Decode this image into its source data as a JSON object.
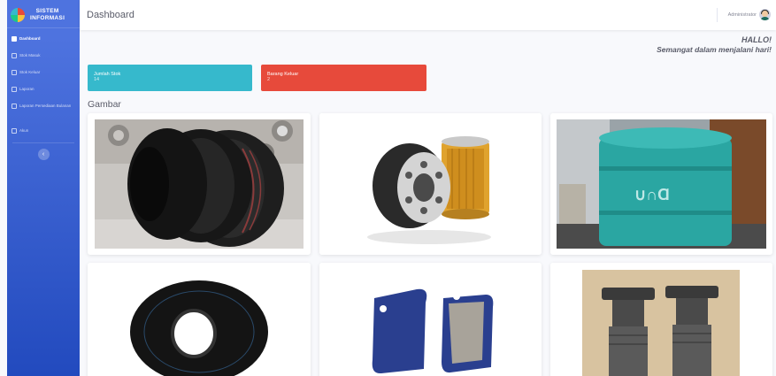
{
  "brand": {
    "line1": "SISTEM",
    "line2": "INFORMASI"
  },
  "sidebar": {
    "items": [
      {
        "label": "Dashboard",
        "icon": "dashboard-icon"
      },
      {
        "label": "Stok Masuk",
        "icon": "list-icon"
      },
      {
        "label": "Stok Keluar",
        "icon": "list-icon"
      },
      {
        "label": "Laporan",
        "icon": "report-icon"
      },
      {
        "label": "Laporan Persediaan Bulanan",
        "icon": "report-icon"
      },
      {
        "label": "Akun",
        "icon": "user-icon"
      }
    ],
    "toggle_icon": "chevron-left-icon"
  },
  "topbar": {
    "title": "Dashboard",
    "user_name": "Administrator"
  },
  "greeting": {
    "line1": "HALLO!",
    "line2": "Semangat dalam menjalani hari!"
  },
  "stats": [
    {
      "label": "Jumlah Stok",
      "value": "14",
      "color": "#36b9cc"
    },
    {
      "label": "Barang Keluar",
      "value": "2",
      "color": "#e74a3b"
    }
  ],
  "gallery": {
    "title": "Gambar",
    "items": [
      {
        "subject": "tires"
      },
      {
        "subject": "oil-filters"
      },
      {
        "subject": "oil-drum"
      },
      {
        "subject": "inner-tube"
      },
      {
        "subject": "brake-pads"
      },
      {
        "subject": "bolts"
      }
    ]
  },
  "colors": {
    "primary": "#4e73df",
    "cyan": "#36b9cc",
    "red": "#e74a3b",
    "text": "#5a5c69"
  }
}
